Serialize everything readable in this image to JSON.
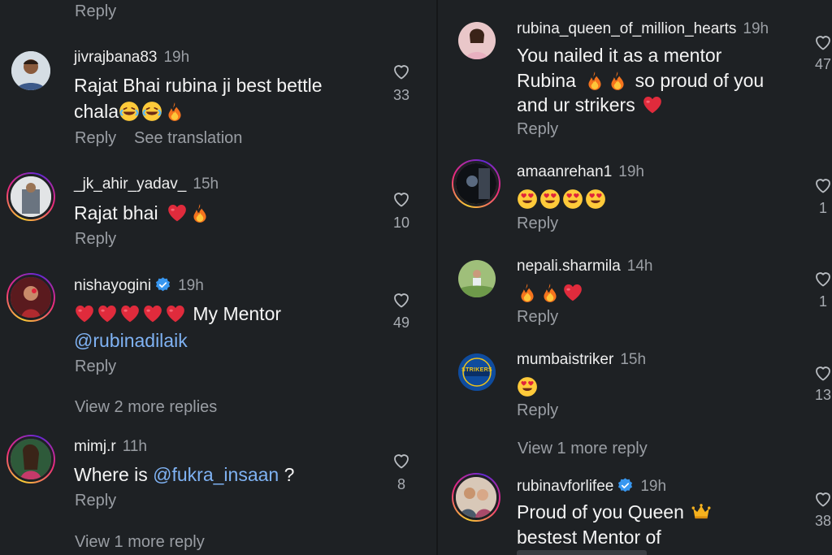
{
  "left": {
    "top_reply": "Reply",
    "comments": [
      {
        "username": "jivrajbana83",
        "time": "19h",
        "line1": "Rajat Bhai rubina ji best bettle",
        "line2": "chala",
        "reply": "Reply",
        "see_translation": "See translation",
        "likes": "33",
        "line2_emoji": [
          "laughing-crying-emoji",
          "laughing-crying-emoji",
          "fire-emoji"
        ]
      },
      {
        "username": "_jk_ahir_yadav_",
        "time": "15h",
        "text": "Rajat bhai",
        "reply": "Reply",
        "likes": "10",
        "emoji": [
          "red-heart-emoji",
          "fire-emoji"
        ]
      },
      {
        "username": "nishayogini",
        "time": "19h",
        "text": "My Mentor",
        "mention": "@rubinadilaik",
        "reply": "Reply",
        "likes": "49",
        "verified": true,
        "emoji": [
          "red-heart-emoji",
          "red-heart-emoji",
          "red-heart-emoji",
          "red-heart-emoji",
          "red-heart-emoji"
        ]
      },
      {
        "username": "mimj.r",
        "time": "11h",
        "text_before": "Where is ",
        "mention": "@fukra_insaan",
        "text_after": " ?",
        "reply": "Reply",
        "likes": "8"
      }
    ],
    "view_more_1": "View 2 more replies",
    "view_more_2": "View 1 more reply"
  },
  "right": {
    "comments": [
      {
        "username": "rubina_queen_of_million_hearts",
        "time": "19h",
        "line1": "You nailed it as a mentor",
        "line2": "Rubina",
        "line2b": "so proud of you",
        "line3": "and ur strikers",
        "reply": "Reply",
        "likes": "47"
      },
      {
        "username": "amaanrehan1",
        "time": "19h",
        "reply": "Reply",
        "likes": "1",
        "emoji": [
          "heart-eyes-emoji",
          "heart-eyes-emoji",
          "heart-eyes-emoji",
          "heart-eyes-emoji"
        ]
      },
      {
        "username": "nepali.sharmila",
        "time": "14h",
        "reply": "Reply",
        "likes": "1",
        "emoji": [
          "fire-emoji",
          "fire-emoji",
          "red-heart-emoji"
        ]
      },
      {
        "username": "mumbaistriker",
        "time": "15h",
        "reply": "Reply",
        "likes": "13",
        "avatar_text": "STRIKERS",
        "emoji": [
          "heart-eyes-emoji"
        ]
      },
      {
        "username": "rubinavforlifee",
        "time": "19h",
        "line1": "Proud of you Queen",
        "line2": "bestest Mentor of",
        "likes": "38",
        "verified": true
      }
    ],
    "view_more": "View 1 more reply"
  },
  "colors": {
    "background": "#1e2124",
    "text": "#f2f2f2",
    "muted": "#9a9ea4",
    "mention": "#7fb2f3",
    "verified": "#3897f0",
    "heart_red": "#e0245e"
  }
}
